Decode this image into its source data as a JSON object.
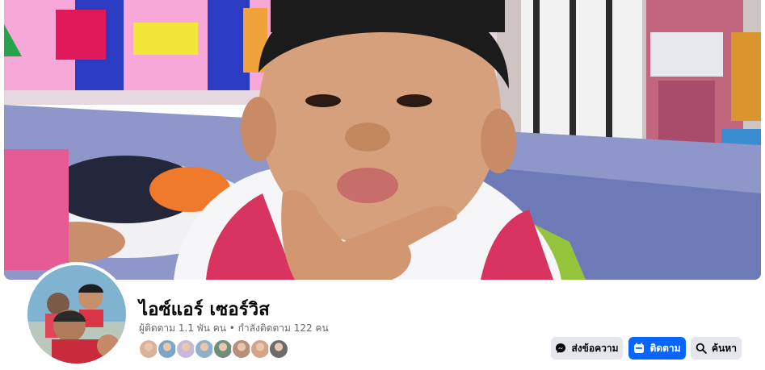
{
  "profile": {
    "name": "ไอซ์แอร์ เซอร์วิส",
    "followers_text": "ผู้ติดตาม 1.1 พัน คน",
    "separator": " • ",
    "following_text": "กำลังติดตาม 122 คน"
  },
  "friends": {
    "avatar_colors": [
      "#d9b49a",
      "#7aa7c7",
      "#c9b8d9",
      "#8fb0c9",
      "#6f8f7a",
      "#b58f7a",
      "#d2a48a",
      "#6b6b6b"
    ]
  },
  "actions": {
    "message_label": "ส่งข้อความ",
    "message_icon": "messenger-icon",
    "follow_label": "ติดตาม",
    "follow_icon": "follow-icon",
    "search_label": "ค้นหา",
    "search_icon": "search-icon"
  },
  "colors": {
    "primary": "#0866ff",
    "secondary_button": "#e4e6eb",
    "text_primary": "#050505",
    "text_secondary": "#65676b"
  }
}
